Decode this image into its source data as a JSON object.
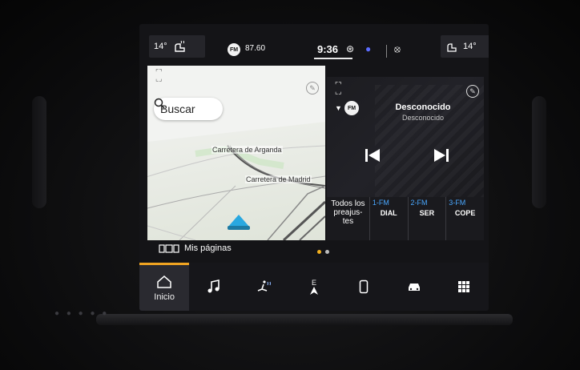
{
  "status_bar": {
    "temp_left": "14°",
    "temp_right": "14°",
    "radio_band": "FM",
    "radio_freq": "87.60",
    "clock": "9:36"
  },
  "map": {
    "search_label": "Buscar",
    "roads": [
      "Carretera de Arganda",
      "Carretera de Madrid"
    ]
  },
  "radio": {
    "band": "FM",
    "station_name": "Desconocido",
    "station_sub": "Desconocido"
  },
  "presets": {
    "all_label_lines": [
      "Todos los",
      "preajus-",
      "tes"
    ],
    "items": [
      {
        "num": "1-FM",
        "name": "DIAL"
      },
      {
        "num": "2-FM",
        "name": "SER"
      },
      {
        "num": "3-FM",
        "name": "COPE"
      }
    ]
  },
  "pages": {
    "label": "Mis páginas"
  },
  "nav": {
    "items": [
      {
        "label": "Inicio",
        "icon": "home-icon",
        "active": true
      },
      {
        "label": "",
        "icon": "music-icon"
      },
      {
        "label": "",
        "icon": "climate-icon"
      },
      {
        "label": "",
        "icon": "compass-icon"
      },
      {
        "label": "",
        "icon": "phone-icon"
      },
      {
        "label": "",
        "icon": "car-icon"
      },
      {
        "label": "",
        "icon": "apps-grid-icon"
      }
    ],
    "compass_letters": "E"
  },
  "colors": {
    "accent": "#f0a422",
    "preset_blue": "#4aa8ff",
    "nav_arrow": "#29a8e0"
  }
}
